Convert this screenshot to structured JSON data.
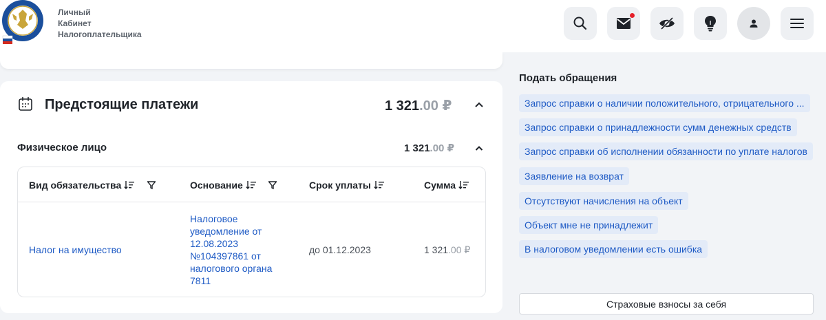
{
  "header": {
    "brand_line1": "Личный",
    "brand_line2": "Кабинет",
    "brand_line3": "Налогоплательщика",
    "icons": [
      "search-icon",
      "mail-icon",
      "eye-off-icon",
      "lightbulb-icon",
      "user-icon",
      "menu-icon"
    ],
    "has_notification": true,
    "notification_color": "#e5202a"
  },
  "payments": {
    "title": "Предстоящие платежи",
    "amount_whole": "1 321",
    "amount_cents": ".00",
    "currency": "₽",
    "person": {
      "title": "Физическое лицо",
      "amount_whole": "1 321",
      "amount_cents": ".00",
      "currency": "₽"
    },
    "table": {
      "columns": [
        "Вид обязательства",
        "Основание",
        "Срок уплаты",
        "Сумма"
      ],
      "rows": [
        {
          "type": "Налог на имущество",
          "basis": "Налоговое уведомление от 12.08.2023 №104397861 от налогового органа 7811",
          "due": "до 01.12.2023",
          "sum_whole": "1 321",
          "sum_cents": ".00",
          "sum_currency": "₽"
        }
      ]
    }
  },
  "requests": {
    "title": "Подать обращения",
    "items": [
      "Запрос справки о наличии положительного, отрицательного ...",
      "Запрос справки о принадлежности сумм денежных средств",
      "Запрос справки об исполнении обязанности по уплате налогов",
      "Заявление на возврат",
      "Отсутствуют начисления на объект",
      "Объект мне не принадлежит",
      "В налоговом уведомлении есть ошибка"
    ],
    "insurance_button": "Страховые взносы за себя"
  },
  "colors": {
    "link": "#1f5bc5",
    "chip_bg": "#e3ebf8",
    "page_bg": "#f2f4f7"
  }
}
